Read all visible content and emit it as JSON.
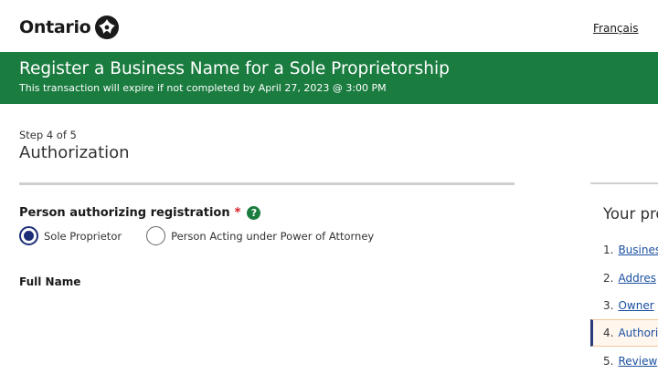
{
  "header": {
    "logo_text": "Ontario",
    "logo_icon": "ontario-trillium-icon",
    "language_link": "Français"
  },
  "banner": {
    "title": "Register a Business Name for a Sole Proprietorship",
    "subtitle": "This transaction will expire if not completed by April 27, 2023 @ 3:00 PM",
    "background": "#1a7c3f"
  },
  "form": {
    "step_label": "Step 4 of 5",
    "step_title": "Authorization",
    "authorizer_label": "Person authorizing registration",
    "required_marker": "*",
    "help_icon": "?",
    "options": [
      {
        "label": "Sole Proprietor",
        "selected": true
      },
      {
        "label": "Person Acting under Power of Attorney",
        "selected": false
      }
    ],
    "full_name_label": "Full Name"
  },
  "progress": {
    "title": "Your pro",
    "items": [
      {
        "number": "1.",
        "label": "Busines",
        "current": false
      },
      {
        "number": "2.",
        "label": "Addres",
        "current": false
      },
      {
        "number": "3.",
        "label": "Owner",
        "current": false
      },
      {
        "number": "4.",
        "label": "Authori",
        "current": true
      },
      {
        "number": "5.",
        "label": "Review",
        "current": false
      }
    ]
  },
  "colors": {
    "brand_green": "#1a7c3f",
    "radio_selected": "#1c2d78",
    "required_red": "#d81a21",
    "link_blue": "#1a4fa0"
  }
}
